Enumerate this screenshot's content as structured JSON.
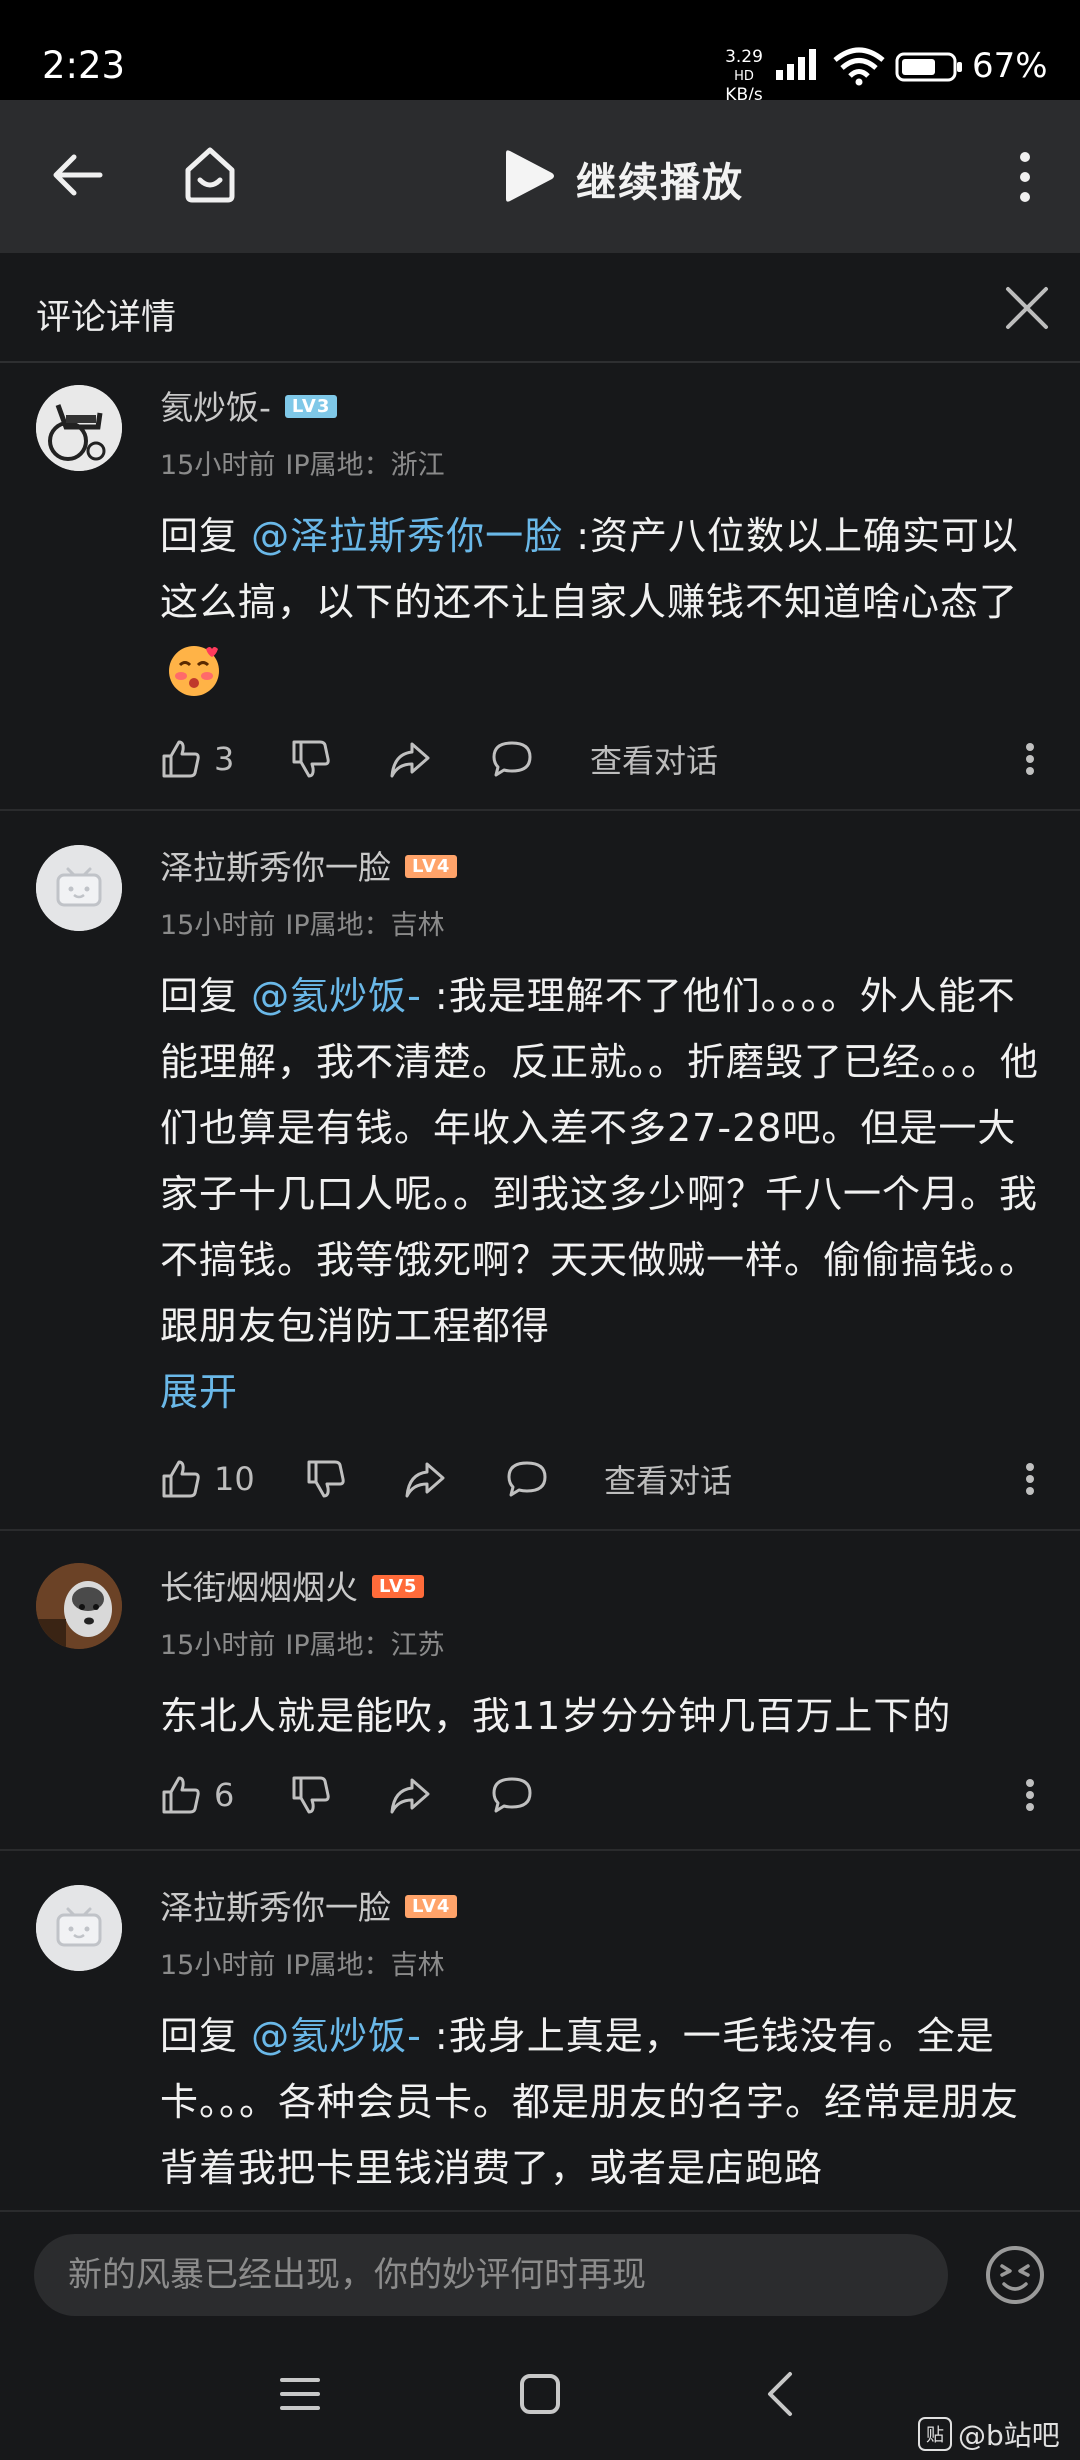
{
  "status_bar": {
    "time": "2:23",
    "net_speed": "3.29",
    "net_unit": "KB/s",
    "net_badge": "HD",
    "battery": "67%",
    "signal_icon": "signal-icon",
    "wifi_icon": "wifi-icon",
    "battery_icon": "battery-icon"
  },
  "top_nav": {
    "back_icon": "back-arrow-icon",
    "home_icon": "home-icon",
    "play_icon": "play-icon",
    "title": "继续播放",
    "more_icon": "more-vertical-icon"
  },
  "panel": {
    "title": "评论详情",
    "close_icon": "close-icon"
  },
  "comments": [
    {
      "username": "氦炒饭-",
      "level": "LV3",
      "time": "15小时前",
      "location": "IP属地：浙江",
      "reply_prefix": "回复 ",
      "mention": "@泽拉斯秀你一脸",
      "text": " :资产八位数以上确实可以这么搞，以下的还不让自家人赚钱不知道啥心态了",
      "emoji_icon": "kiss-face-emoji-icon",
      "likes": "3",
      "view_conversation": "查看对话"
    },
    {
      "username": "泽拉斯秀你一脸",
      "level": "LV4",
      "time": "15小时前",
      "location": "IP属地：吉林",
      "reply_prefix": "回复 ",
      "mention": "@氦炒饭-",
      "text": " :我是理解不了他们。。。。外人能不能理解，我不清楚。反正就。。折磨毁了已经。。。他们也算是有钱。年收入差不多27-28吧。但是一大家子十几口人呢。。到我这多少啊？千八一个月。我不搞钱。我等饿死啊？天天做贼一样。偷偷搞钱。。跟朋友包消防工程都得",
      "expand": "展开",
      "likes": "10",
      "view_conversation": "查看对话"
    },
    {
      "username": "长街烟烟烟火",
      "level": "LV5",
      "time": "15小时前",
      "location": "IP属地：江苏",
      "text": "东北人就是能吹，我11岁分分钟几百万上下的",
      "likes": "6"
    },
    {
      "username": "泽拉斯秀你一脸",
      "level": "LV4",
      "time": "15小时前",
      "location": "IP属地：吉林",
      "reply_prefix": "回复 ",
      "mention": "@氦炒饭-",
      "text": " :我身上真是，一毛钱没有。全是卡。。。各种会员卡。都是朋友的名字。经常是朋友背着我把卡里钱消费了，或者是店跑路"
    }
  ],
  "input_bar": {
    "placeholder": "新的风暴已经出现，你的妙评何时再现",
    "emoji_button_icon": "emoji-face-icon"
  },
  "system_nav": {
    "menu_icon": "recent-apps-icon",
    "home_icon": "system-home-icon",
    "back_icon": "system-back-icon"
  },
  "watermark": {
    "badge": "贴",
    "text": "@b站吧"
  },
  "colors": {
    "background": "#17181a",
    "header": "#2b2c2e",
    "mention": "#6ab8e8",
    "lv3": "#7fc8e8",
    "lv4": "#ffa36a",
    "lv5": "#ff6b3a"
  }
}
